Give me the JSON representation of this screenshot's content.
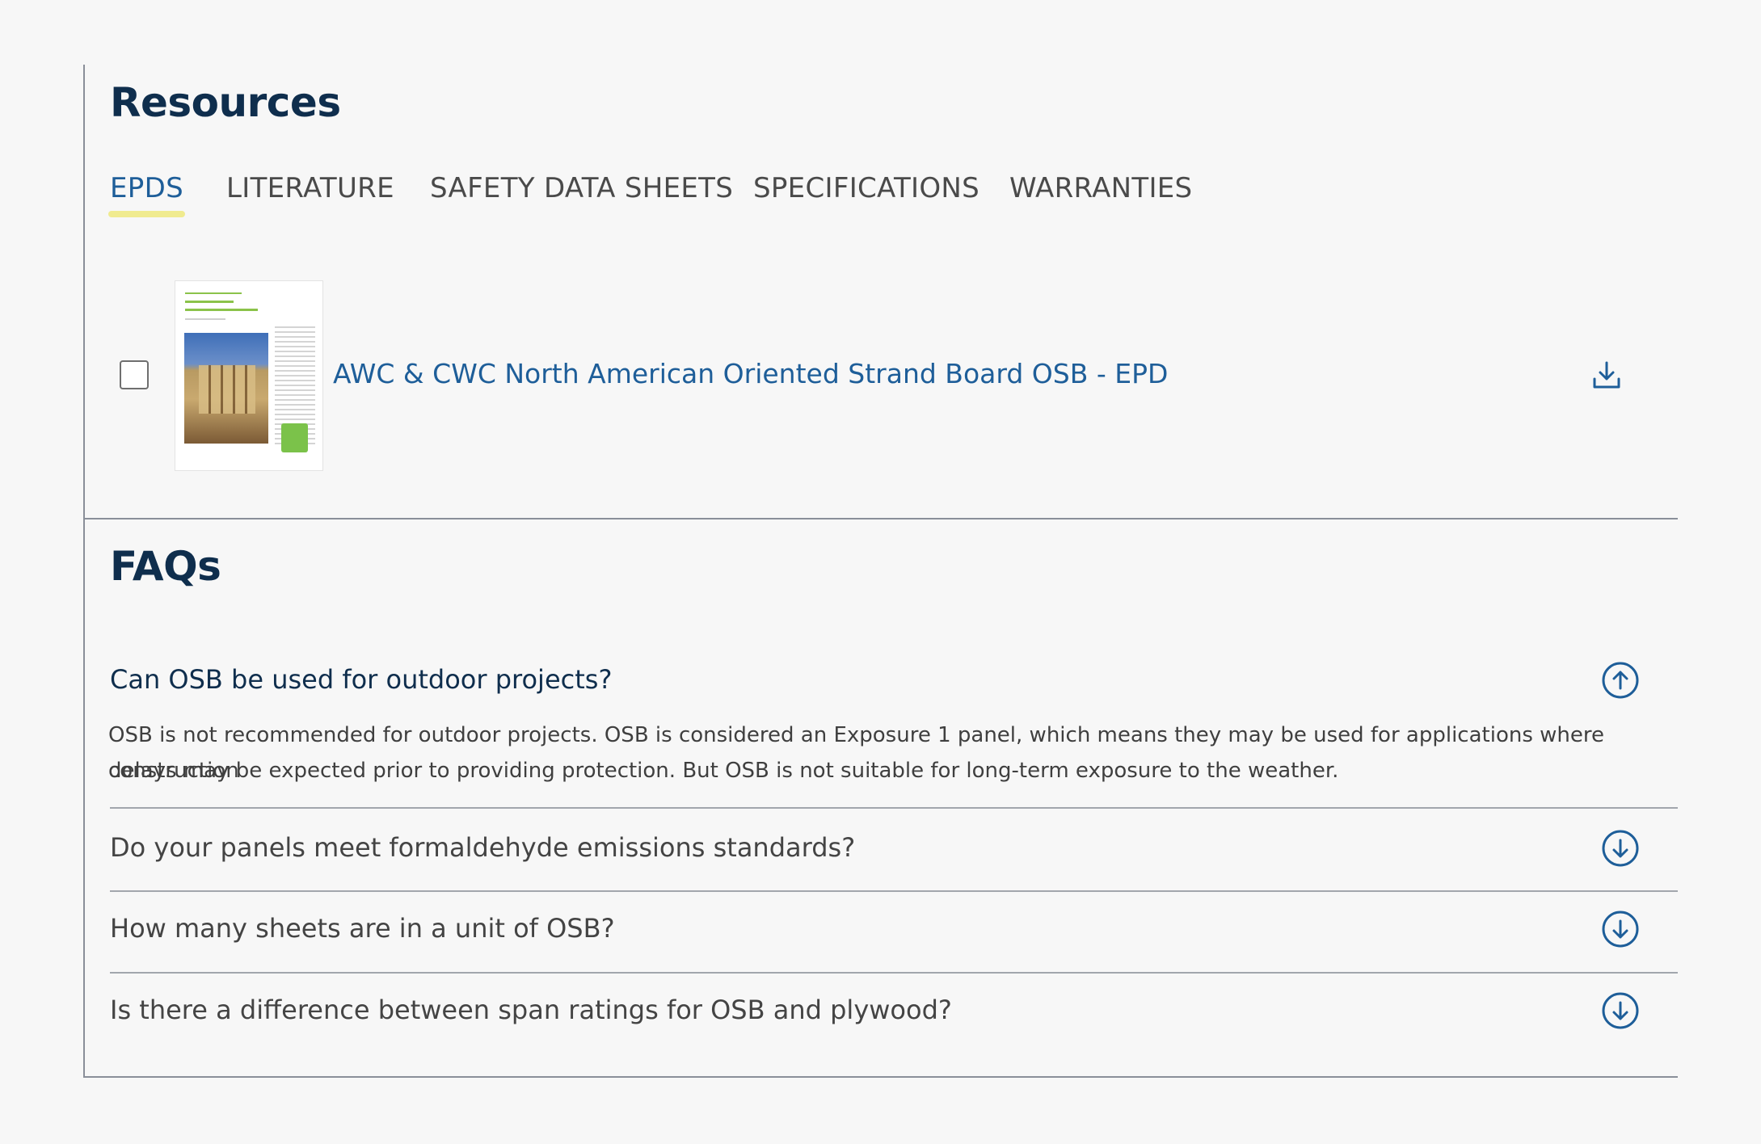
{
  "resources": {
    "heading": "Resources",
    "tabs": [
      {
        "label": "EPDS",
        "active": true
      },
      {
        "label": "LITERATURE",
        "active": false
      },
      {
        "label": "SAFETY DATA SHEETS",
        "active": false
      },
      {
        "label": "SPECIFICATIONS",
        "active": false
      },
      {
        "label": "WARRANTIES",
        "active": false
      }
    ],
    "items": [
      {
        "title": "AWC & CWC North American Oriented Strand Board OSB - EPD",
        "checked": false,
        "icon": "download-icon"
      }
    ]
  },
  "faqs": {
    "heading": "FAQs",
    "items": [
      {
        "question": "Can OSB be used for outdoor projects?",
        "expanded": true,
        "icon": "arrow-up-circle-icon",
        "answer_line1": "OSB is not recommended for outdoor projects. OSB is considered an Exposure 1 panel, which means they may be used for applications where construction",
        "answer_line2": "delays may be expected prior to providing protection. But OSB is not suitable for long-term exposure to the weather."
      },
      {
        "question": "Do your panels meet formaldehyde emissions standards?",
        "expanded": false,
        "icon": "arrow-down-circle-icon"
      },
      {
        "question": "How many sheets are in a unit of OSB?",
        "expanded": false,
        "icon": "arrow-down-circle-icon"
      },
      {
        "question": "Is there a difference between span ratings for OSB and plywood?",
        "expanded": false,
        "icon": "arrow-down-circle-icon"
      }
    ]
  },
  "colors": {
    "heading": "#0f2e4d",
    "link": "#1e5e99",
    "tab_underline": "#f0eb8f",
    "divider": "#8a8f99",
    "background": "#f7f7f7"
  }
}
